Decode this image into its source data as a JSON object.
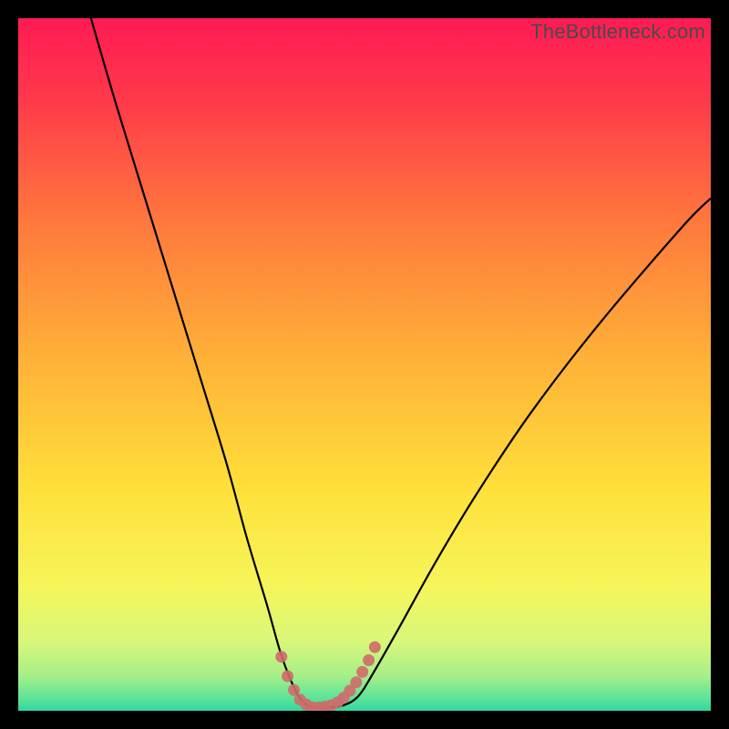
{
  "watermark": {
    "text": "TheBottleneck.com"
  },
  "colors": {
    "border": "#000000",
    "curve_stroke": "#000000",
    "marker_stroke": "#cf6a6a",
    "gradient_stops": [
      {
        "offset": 0.0,
        "color": "#ff1a54"
      },
      {
        "offset": 0.12,
        "color": "#ff3a4a"
      },
      {
        "offset": 0.3,
        "color": "#ff7a3c"
      },
      {
        "offset": 0.5,
        "color": "#ffb338"
      },
      {
        "offset": 0.68,
        "color": "#ffe03a"
      },
      {
        "offset": 0.82,
        "color": "#f6f55a"
      },
      {
        "offset": 0.9,
        "color": "#d8f77a"
      },
      {
        "offset": 0.95,
        "color": "#a6ef88"
      },
      {
        "offset": 0.985,
        "color": "#55e29a"
      },
      {
        "offset": 1.0,
        "color": "#2fd89f"
      }
    ]
  },
  "chart_data": {
    "type": "line",
    "title": "",
    "xlabel": "",
    "ylabel": "",
    "xlim": [
      0,
      100
    ],
    "ylim": [
      0,
      100
    ],
    "series": [
      {
        "name": "bottleneck-curve",
        "x": [
          10.5,
          14,
          18,
          22,
          26,
          30,
          33,
          36,
          38,
          40,
          41.5,
          43,
          45,
          47,
          49,
          51,
          55,
          60,
          66,
          74,
          84,
          96,
          100
        ],
        "y": [
          100,
          88,
          75,
          62,
          49,
          36,
          25,
          15,
          8,
          3,
          1,
          0.5,
          0.5,
          0.8,
          2,
          5,
          12,
          21,
          31,
          43,
          56,
          70,
          74
        ]
      }
    ],
    "markers": {
      "name": "optimal-range",
      "x": [
        38.0,
        38.9,
        39.8,
        40.7,
        41.6,
        42.5,
        43.4,
        44.3,
        45.2,
        46.1,
        47.0,
        47.9,
        48.8,
        49.7,
        50.6,
        51.5
      ],
      "y": [
        7.8,
        5.0,
        3.0,
        1.6,
        0.9,
        0.5,
        0.5,
        0.6,
        0.8,
        1.2,
        1.9,
        2.9,
        4.1,
        5.6,
        7.3,
        9.2
      ]
    }
  }
}
